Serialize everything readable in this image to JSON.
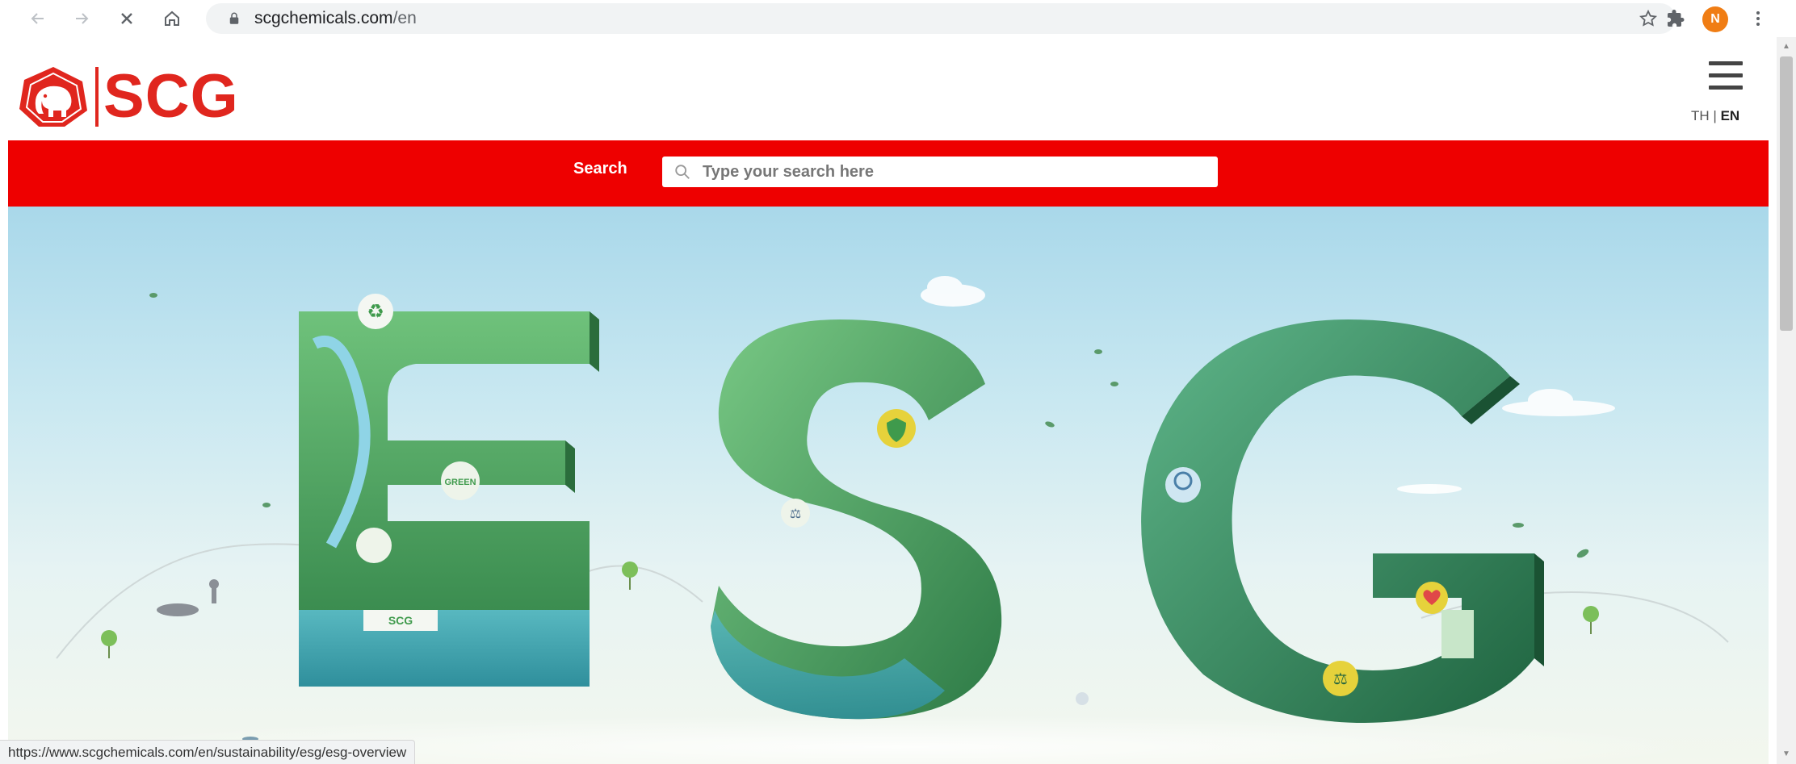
{
  "browser": {
    "url_domain": "scgchemicals.com",
    "url_path": "/en",
    "profile_initial": "N",
    "status_url": "https://www.scgchemicals.com/en/sustainability/esg/esg-overview"
  },
  "header": {
    "brand": "SCG",
    "lang_th": "TH",
    "lang_sep": "|",
    "lang_en": "EN"
  },
  "search": {
    "label": "Search",
    "placeholder": "Type your search here"
  },
  "hero": {
    "letters": [
      "E",
      "S",
      "G"
    ],
    "badge_recycle_icon": "recycle-icon",
    "badge_safety_icon": "shield-check-icon",
    "badge_heart_icon": "heart-icon",
    "badge_scales_icon": "scales-icon",
    "badge_green_text": "GREEN",
    "badge_scg_text": "SCG"
  },
  "colors": {
    "brand_red": "#e0261e",
    "search_band": "#ee0000",
    "letter_green": "#3f9a4c"
  }
}
